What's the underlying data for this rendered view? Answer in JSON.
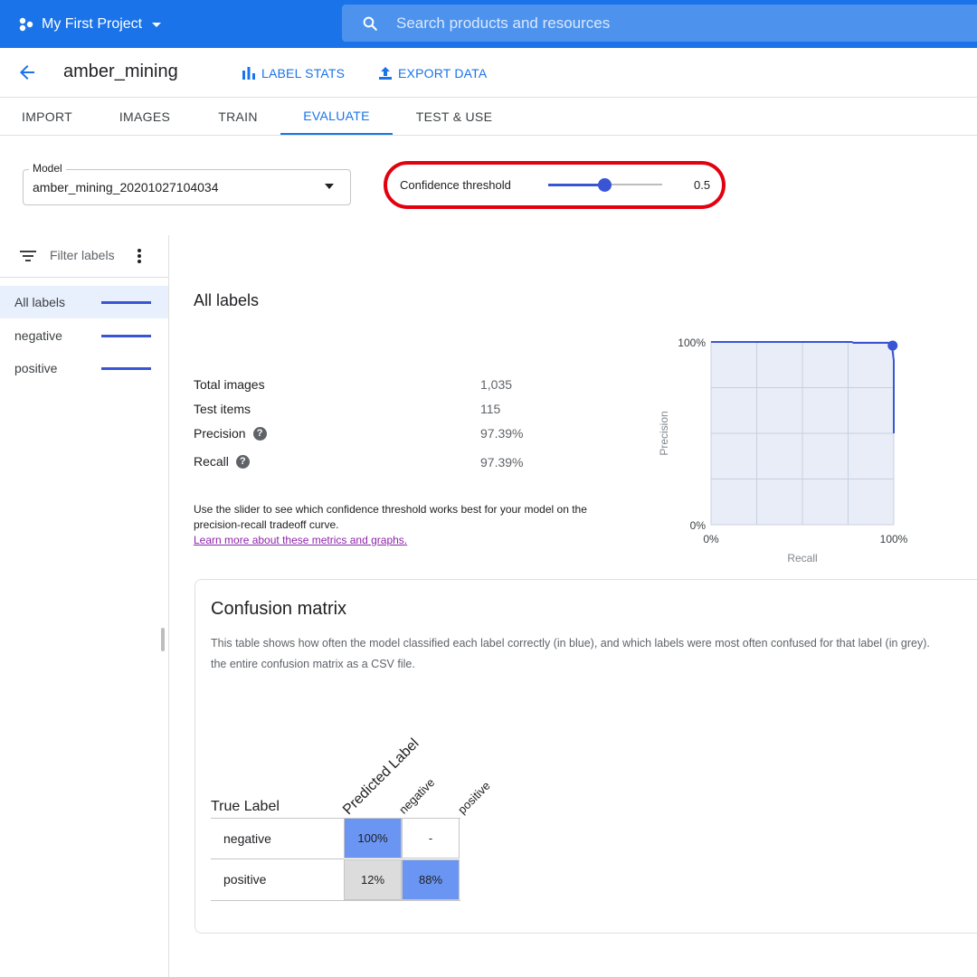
{
  "topbar": {
    "project_name": "My First Project",
    "search_placeholder": "Search products and resources"
  },
  "header": {
    "dataset_title": "amber_mining",
    "label_stats": "LABEL STATS",
    "export_data": "EXPORT DATA"
  },
  "tabs": [
    {
      "label": "IMPORT"
    },
    {
      "label": "IMAGES"
    },
    {
      "label": "TRAIN"
    },
    {
      "label": "EVALUATE",
      "active": true
    },
    {
      "label": "TEST & USE"
    }
  ],
  "model": {
    "label": "Model",
    "value": "amber_mining_20201027104034"
  },
  "confidence": {
    "label": "Confidence threshold",
    "value": "0.5",
    "slider_fraction": 0.5
  },
  "sidebar": {
    "filter_placeholder": "Filter labels",
    "items": [
      {
        "label": "All labels",
        "selected": true
      },
      {
        "label": "negative"
      },
      {
        "label": "positive"
      }
    ]
  },
  "stats": {
    "title": "All labels",
    "rows": [
      {
        "label": "Total images",
        "value": "1,035"
      },
      {
        "label": "Test items",
        "value": "115"
      },
      {
        "label": "Precision",
        "value": "97.39%"
      },
      {
        "label": "Recall",
        "value": "97.39%"
      }
    ],
    "description": "Use the slider to see which confidence threshold works best for your model on the precision-recall tradeoff curve.",
    "learn_more": "Learn more about these metrics and graphs."
  },
  "chart_data": {
    "type": "line",
    "xlabel": "Recall",
    "ylabel": "Precision",
    "x_tick_labels": [
      "0%",
      "100%"
    ],
    "y_tick_labels": [
      "100%",
      "0%"
    ],
    "xlim": [
      0,
      1
    ],
    "ylim": [
      0,
      1
    ],
    "grid": true,
    "series": [
      {
        "x": [
          0.0,
          0.5,
          0.77,
          0.78,
          0.97,
          0.99,
          1.0,
          1.0
        ],
        "y": [
          1.0,
          1.0,
          1.0,
          0.995,
          0.995,
          0.975,
          0.9,
          0.5
        ]
      }
    ],
    "threshold_point": {
      "x": 0.974,
      "y": 0.974
    }
  },
  "confusion_matrix": {
    "title": "Confusion matrix",
    "description_line1": "This table shows how often the model classified each label correctly (in blue), and which labels were most often confused for that label (in grey).",
    "description_line2": "the entire confusion matrix as a CSV file.",
    "true_label": "True Label",
    "predicted_label": "Predicted Label",
    "columns": [
      "negative",
      "positive"
    ],
    "rows": [
      {
        "label": "negative",
        "cells": [
          "100%",
          "-"
        ]
      },
      {
        "label": "positive",
        "cells": [
          "12%",
          "88%"
        ]
      }
    ],
    "colors": {
      "correct": "#6a95f2",
      "confused": "#dcdcdc",
      "empty": "#ffffff"
    }
  },
  "colors": {
    "brand_blue": "#1a73e8",
    "series_blue": "#3955d4",
    "highlight_red": "#e3000f"
  }
}
